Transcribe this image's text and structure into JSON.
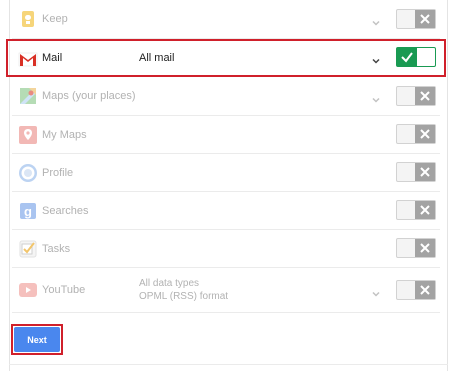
{
  "rows": [
    {
      "name": "Keep",
      "icon": "keep-icon",
      "enabled": false
    },
    {
      "name": "Mail",
      "detail": "All mail",
      "icon": "mail-icon",
      "enabled": true,
      "highlighted": true
    },
    {
      "name": "Maps (your places)",
      "icon": "maps-icon",
      "enabled": false
    },
    {
      "name": "My Maps",
      "icon": "my-maps-icon",
      "enabled": false
    },
    {
      "name": "Profile",
      "icon": "profile-icon",
      "enabled": false
    },
    {
      "name": "Searches",
      "icon": "searches-icon",
      "enabled": false
    },
    {
      "name": "Tasks",
      "icon": "tasks-icon",
      "enabled": false
    },
    {
      "name": "YouTube",
      "detail_line1": "All data types",
      "detail_line2": "OPML (RSS) format",
      "icon": "youtube-icon",
      "enabled": false
    }
  ],
  "next_label": "Next",
  "colors": {
    "toggle_on": "#199a52",
    "toggle_off_knob": "#a3a3a3",
    "button_blue": "#4a87ee",
    "highlight_red": "#d0202b"
  }
}
